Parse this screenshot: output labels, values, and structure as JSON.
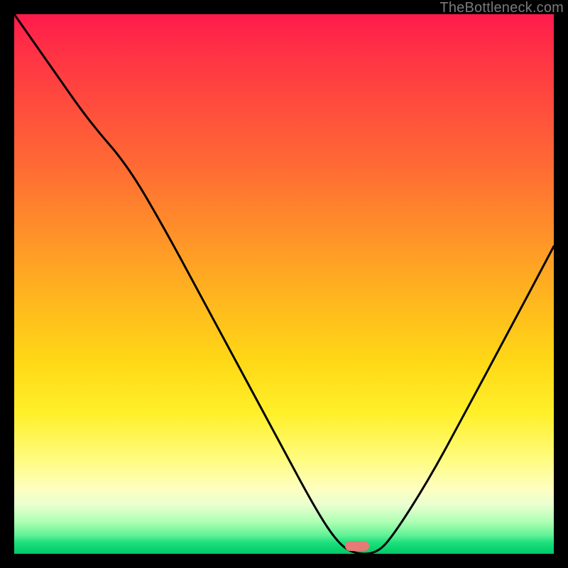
{
  "attribution": "TheBottleneck.com",
  "gradient_colors": {
    "top": "#ff1a4d",
    "mid_upper": "#ff8f2a",
    "mid": "#ffd716",
    "mid_lower": "#fffb7a",
    "bottom": "#03c867"
  },
  "marker": {
    "x_frac": 0.635,
    "y_frac": 0.985,
    "color": "#e77a74"
  },
  "chart_data": {
    "type": "line",
    "title": "",
    "xlabel": "",
    "ylabel": "",
    "xlim": [
      0,
      1
    ],
    "ylim": [
      0,
      1
    ],
    "series": [
      {
        "name": "bottleneck-curve",
        "x": [
          0.0,
          0.07,
          0.14,
          0.21,
          0.28,
          0.35,
          0.42,
          0.49,
          0.56,
          0.6,
          0.63,
          0.67,
          0.7,
          0.77,
          0.84,
          0.91,
          1.0
        ],
        "y": [
          1.0,
          0.9,
          0.8,
          0.72,
          0.6,
          0.47,
          0.34,
          0.21,
          0.08,
          0.02,
          0.0,
          0.0,
          0.03,
          0.14,
          0.27,
          0.4,
          0.57
        ],
        "note": "y is fraction of plot height from bottom; curve descends from top-left, has a knee around x≈0.21, reaches 0 near x≈0.63–0.67, then rises to ≈0.57 at right edge"
      }
    ],
    "marker_point": {
      "x": 0.635,
      "y": 0.015
    }
  }
}
